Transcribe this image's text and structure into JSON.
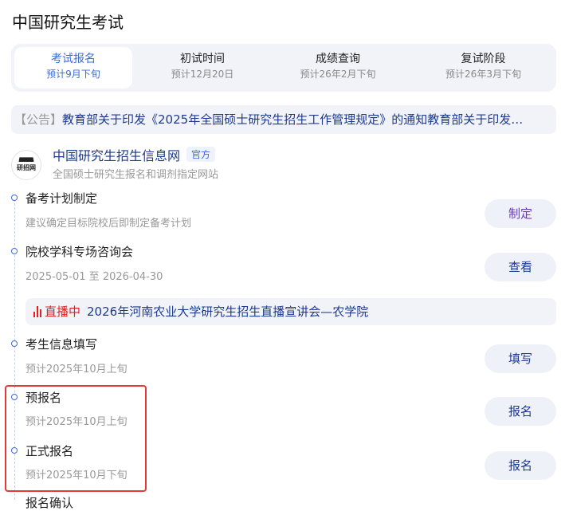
{
  "page_title": "中国研究生考试",
  "tabs": [
    {
      "label": "考试报名",
      "sub": "预计9月下旬",
      "active": true
    },
    {
      "label": "初试时间",
      "sub": "预计12月20日",
      "active": false
    },
    {
      "label": "成绩查询",
      "sub": "预计26年2月下旬",
      "active": false
    },
    {
      "label": "复试阶段",
      "sub": "预计26年3月下旬",
      "active": false
    }
  ],
  "notice": {
    "tag": "【公告】",
    "text": "教育部关于印发《2025年全国硕士研究生招生工作管理规定》的通知教育部关于印发",
    "ellipsis": "…"
  },
  "site": {
    "logo_text": "研招网",
    "name": "中国研究生招生信息网",
    "badge": "官方",
    "desc": "全国硕士研究生报名和调剂指定网站"
  },
  "steps": [
    {
      "name": "备考计划制定",
      "sub": "建议确定目标院校后即制定备考计划",
      "button": "制定"
    },
    {
      "name": "院校学科专场咨询会",
      "sub": "2025-05-01 至 2026-04-30",
      "button": "查看"
    },
    {
      "name": "考生信息填写",
      "sub": "预计2025年10月上旬",
      "button": "填写"
    },
    {
      "name": "预报名",
      "sub": "预计2025年10月上旬",
      "button": "报名"
    },
    {
      "name": "正式报名",
      "sub": "预计2025年10月下旬",
      "button": "报名"
    }
  ],
  "live": {
    "label": "直播中",
    "text": "2026年河南农业大学研究生招生直播宣讲会—农学院"
  },
  "next_step_partial": "报名确认",
  "colors": {
    "accent": "#3d6bd9",
    "link": "#1d3a8f",
    "live_red": "#e02020",
    "highlight": "#e53935"
  }
}
